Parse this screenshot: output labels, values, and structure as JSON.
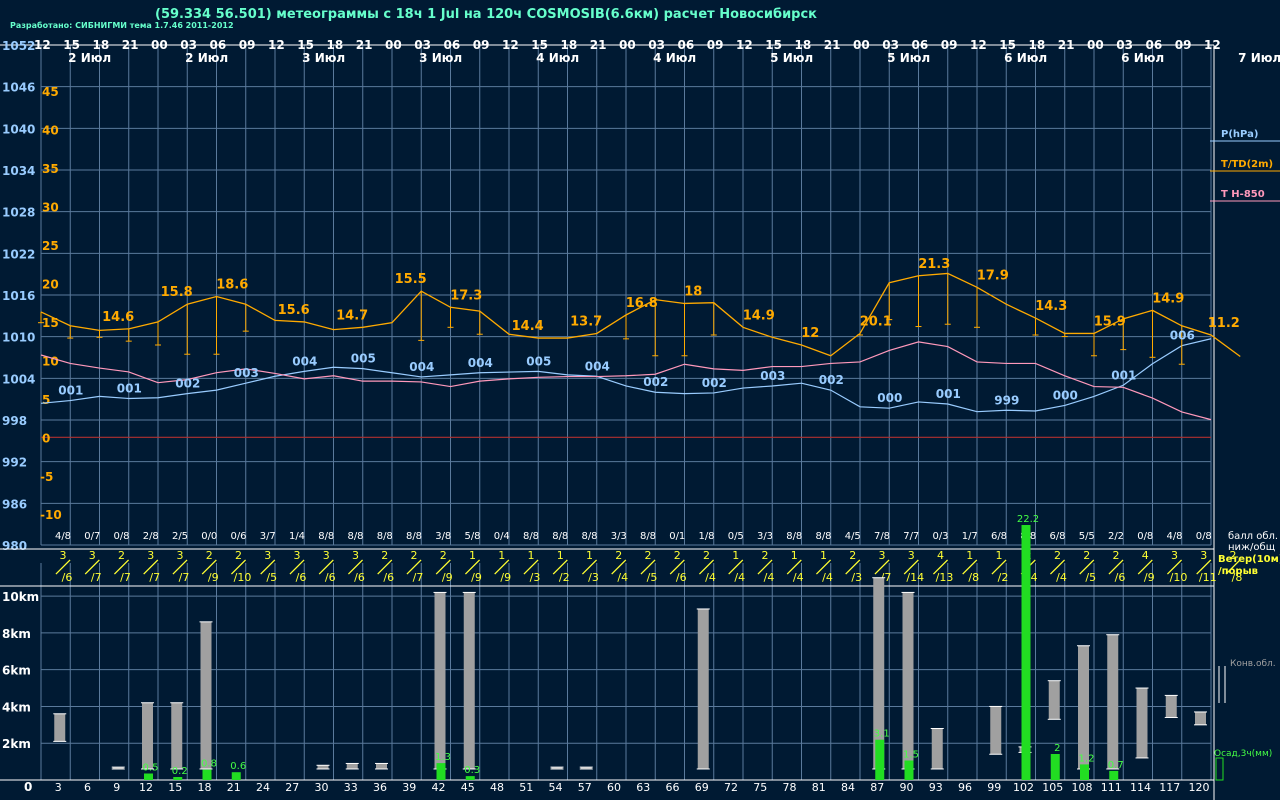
{
  "header": {
    "title": "(59.334 56.501) метеограммы с  18ч 1 Jul на 120ч COSMOSIB(6.6км) расчет Новосибирск",
    "credit": "Разработано: СИБНИГМИ тема 1.7.46 2011-2012"
  },
  "colors": {
    "background": "#001a33",
    "grid": "#5a7a9c",
    "pressure": "#99ccff",
    "temperature": "#ffaa00",
    "t850": "#ff99bb",
    "zero_line": "#b03030",
    "wind": "#ffff33",
    "cloud_bar": "#a0a0a0",
    "precip": "#22dd22",
    "precip_label": "#44ff44",
    "white": "#ffffff"
  },
  "chart_data": {
    "type": "line",
    "hours_top": [
      "12",
      "15",
      "18",
      "21",
      "00",
      "03",
      "06",
      "09",
      "12",
      "15",
      "18",
      "21",
      "00",
      "03",
      "06",
      "09",
      "12",
      "15",
      "18",
      "21",
      "00",
      "03",
      "06",
      "09",
      "12",
      "15",
      "18",
      "21",
      "00",
      "03",
      "06",
      "09",
      "12",
      "15",
      "18",
      "21",
      "00",
      "03",
      "06",
      "09",
      "12"
    ],
    "dates_top": [
      {
        "i": 1.1,
        "text": "2 Июл"
      },
      {
        "i": 5.1,
        "text": "2 Июл"
      },
      {
        "i": 9.1,
        "text": "3 Июл"
      },
      {
        "i": 13.1,
        "text": "3 Июл"
      },
      {
        "i": 17.1,
        "text": "4 Июл"
      },
      {
        "i": 21.1,
        "text": "4 Июл"
      },
      {
        "i": 25.1,
        "text": "5 Июл"
      },
      {
        "i": 29.1,
        "text": "5 Июл"
      },
      {
        "i": 33.1,
        "text": "6 Июл"
      },
      {
        "i": 37.1,
        "text": "6 Июл"
      },
      {
        "i": 41.1,
        "text": "7 Июл"
      }
    ],
    "forecast_hours": [
      "0",
      "3",
      "6",
      "9",
      "12",
      "15",
      "18",
      "21",
      "24",
      "27",
      "30",
      "33",
      "36",
      "39",
      "42",
      "45",
      "48",
      "51",
      "54",
      "57",
      "60",
      "63",
      "66",
      "69",
      "72",
      "75",
      "78",
      "81",
      "84",
      "87",
      "90",
      "93",
      "96",
      "99",
      "102",
      "105",
      "108",
      "111",
      "114",
      "117",
      "120"
    ],
    "pressure_axis": {
      "min": 980,
      "max": 1052,
      "ticks": [
        "1052",
        "1046",
        "1040",
        "1034",
        "1028",
        "1022",
        "1016",
        "1010",
        "1004",
        "998",
        "992",
        "986",
        "980"
      ]
    },
    "temperature_axis": {
      "min": -14,
      "max": 51,
      "ticks": [
        "45",
        "40",
        "35",
        "30",
        "25",
        "20",
        "15",
        "10",
        "5",
        "0",
        "-5",
        "-10"
      ]
    },
    "pressure": [
      1000.4,
      1000.8,
      1001.4,
      1001.1,
      1001.2,
      1001.8,
      1002.3,
      1003.3,
      1004.3,
      1005.0,
      1005.6,
      1005.4,
      1004.8,
      1004.2,
      1004.5,
      1004.8,
      1004.9,
      1005.0,
      1004.5,
      1004.3,
      1002.9,
      1002.0,
      1001.8,
      1001.9,
      1002.6,
      1002.9,
      1003.3,
      1002.3,
      999.9,
      999.7,
      1000.6,
      1000.3,
      999.2,
      999.4,
      999.3,
      1000.1,
      1001.4,
      1003.0,
      1006.1,
      1008.7,
      1009.7
    ],
    "pressure_labels": [
      {
        "i": 1,
        "text": "001"
      },
      {
        "i": 3,
        "text": "001"
      },
      {
        "i": 5,
        "text": "002"
      },
      {
        "i": 7,
        "text": "003"
      },
      {
        "i": 9,
        "text": "004"
      },
      {
        "i": 11,
        "text": "005"
      },
      {
        "i": 13,
        "text": "004"
      },
      {
        "i": 15,
        "text": "004"
      },
      {
        "i": 17,
        "text": "005"
      },
      {
        "i": 19,
        "text": "004"
      },
      {
        "i": 21,
        "text": "002"
      },
      {
        "i": 23,
        "text": "002"
      },
      {
        "i": 25,
        "text": "003"
      },
      {
        "i": 27,
        "text": "002"
      },
      {
        "i": 29,
        "text": "000"
      },
      {
        "i": 31,
        "text": "001"
      },
      {
        "i": 33,
        "text": "999"
      },
      {
        "i": 35,
        "text": "000"
      },
      {
        "i": 37,
        "text": "001"
      },
      {
        "i": 39,
        "text": "006"
      }
    ],
    "temperature": [
      16.3,
      14.5,
      13.9,
      14.1,
      15.0,
      17.3,
      18.3,
      17.3,
      15.2,
      15.0,
      14.0,
      14.3,
      14.9,
      19.0,
      16.9,
      16.4,
      13.4,
      12.9,
      12.9,
      13.5,
      15.9,
      17.9,
      17.4,
      17.5,
      14.3,
      13.0,
      12.0,
      10.6,
      13.5,
      20.1,
      21.0,
      21.3,
      19.5,
      17.3,
      15.5,
      13.5,
      13.5,
      15.4,
      16.5,
      14.5,
      13.3,
      10.5
    ],
    "dewpoint": [
      14.9,
      12.9,
      13.0,
      12.5,
      12.0,
      10.8,
      10.8,
      13.8,
      null,
      null,
      null,
      null,
      null,
      12.6,
      14.3,
      13.4,
      null,
      null,
      null,
      null,
      12.8,
      10.6,
      10.6,
      13.3,
      null,
      null,
      null,
      null,
      13.3,
      15.3,
      14.4,
      14.7,
      14.3,
      null,
      13.3,
      13.1,
      10.6,
      11.4,
      10.4,
      9.5
    ],
    "temperature_labels": [
      {
        "i": 2.5,
        "text": "14.6"
      },
      {
        "i": 4.5,
        "text": "15.8"
      },
      {
        "i": 6.4,
        "text": "18.6"
      },
      {
        "i": 8.5,
        "text": "15.6"
      },
      {
        "i": 10.5,
        "text": "14.7"
      },
      {
        "i": 12.5,
        "text": "15.5"
      },
      {
        "i": 14.4,
        "text": "17.3"
      },
      {
        "i": 16.5,
        "text": "14.4"
      },
      {
        "i": 18.5,
        "text": "13.7"
      },
      {
        "i": 20.4,
        "text": "16.8"
      },
      {
        "i": 22.4,
        "text": "18"
      },
      {
        "i": 24.4,
        "text": "14.9"
      },
      {
        "i": 26.4,
        "text": "12"
      },
      {
        "i": 28.4,
        "text": "20.1"
      },
      {
        "i": 30.4,
        "text": "21.3"
      },
      {
        "i": 32.4,
        "text": "17.9"
      },
      {
        "i": 34.4,
        "text": "14.3"
      },
      {
        "i": 36.4,
        "text": "15.9"
      },
      {
        "i": 38.4,
        "text": "14.9"
      },
      {
        "i": 40.3,
        "text": "11.2"
      }
    ],
    "t850": [
      10.7,
      9.6,
      9.0,
      8.5,
      7.1,
      7.5,
      8.4,
      8.9,
      8.3,
      7.6,
      8.0,
      7.3,
      7.3,
      7.2,
      6.6,
      7.3,
      7.6,
      7.8,
      7.9,
      7.9,
      8.0,
      8.2,
      9.5,
      8.9,
      8.7,
      9.2,
      9.2,
      9.6,
      9.8,
      11.3,
      12.4,
      11.8,
      9.8,
      9.6,
      9.6,
      8.0,
      6.6,
      6.5,
      5.1,
      3.3,
      2.3
    ],
    "cloud_cover": [
      "4/8",
      "0/7",
      "0/8",
      "2/8",
      "2/5",
      "0/0",
      "0/6",
      "3/7",
      "1/4",
      "8/8",
      "8/8",
      "8/8",
      "8/8",
      "3/8",
      "5/8",
      "0/4",
      "8/8",
      "8/8",
      "8/8",
      "3/3",
      "8/8",
      "0/1",
      "1/8",
      "0/5",
      "3/3",
      "8/8",
      "8/8",
      "4/5",
      "7/8",
      "7/7",
      "0/3",
      "1/7",
      "6/8",
      "8/8",
      "6/8",
      "5/5",
      "2/2",
      "0/8",
      "4/8",
      "0/8"
    ],
    "cloud_cover_label": [
      "балл обл.",
      "ниж/общ"
    ],
    "wind_speed": [
      "3",
      "3",
      "2",
      "3",
      "3",
      "2",
      "2",
      "3",
      "3",
      "3",
      "3",
      "2",
      "2",
      "2",
      "1",
      "1",
      "1",
      "1",
      "1",
      "2",
      "2",
      "2",
      "2",
      "1",
      "2",
      "1",
      "1",
      "2",
      "3",
      "3",
      "4",
      "1",
      "1",
      "2",
      "2",
      "2",
      "2",
      "4",
      "3",
      "3",
      "2"
    ],
    "wind_gust": [
      "/6",
      "/7",
      "/7",
      "/7",
      "/7",
      "/9",
      "/10",
      "/5",
      "/6",
      "/6",
      "/6",
      "/6",
      "/7",
      "/9",
      "/9",
      "/9",
      "/3",
      "/2",
      "/3",
      "/4",
      "/5",
      "/6",
      "/4",
      "/4",
      "/4",
      "/4",
      "/4",
      "/3",
      "/7",
      "/14",
      "/13",
      "/8",
      "/2",
      "/4",
      "/4",
      "/5",
      "/6",
      "/9",
      "/10",
      "/11",
      "/8"
    ],
    "wind_dir": [
      135,
      135,
      135,
      135,
      135,
      135,
      135,
      135,
      135,
      135,
      135,
      135,
      135,
      135,
      135,
      135,
      135,
      135,
      135,
      135,
      135,
      135,
      135,
      135,
      135,
      135,
      135,
      135,
      135,
      135,
      135,
      135,
      135,
      135,
      135,
      135,
      135,
      135,
      135,
      135,
      135
    ],
    "wind_label": [
      "Ветер(10м)",
      "/порыв"
    ],
    "cloud_axis_ticks": [
      "10km",
      "8km",
      "6km",
      "4km",
      "2km",
      "0"
    ],
    "convective_clouds": [
      {
        "i": 1,
        "base": 2.1,
        "top": 3.6
      },
      {
        "i": 3,
        "base": 0.6,
        "top": 0.7
      },
      {
        "i": 4,
        "base": 0.6,
        "top": 4.2
      },
      {
        "i": 5,
        "base": 0.6,
        "top": 4.2
      },
      {
        "i": 6,
        "base": 0.6,
        "top": 8.6
      },
      {
        "i": 10,
        "base": 0.6,
        "top": 0.8
      },
      {
        "i": 11,
        "base": 0.6,
        "top": 0.9
      },
      {
        "i": 12,
        "base": 0.6,
        "top": 0.9
      },
      {
        "i": 14,
        "base": 0.6,
        "top": 10.2
      },
      {
        "i": 15,
        "base": 0.6,
        "top": 10.2
      },
      {
        "i": 18,
        "base": 0.6,
        "top": 0.7
      },
      {
        "i": 19,
        "base": 0.6,
        "top": 0.7
      },
      {
        "i": 23,
        "base": 0.6,
        "top": 9.3
      },
      {
        "i": 29,
        "base": 0.6,
        "top": 11.0
      },
      {
        "i": 30,
        "base": 0.6,
        "top": 10.2
      },
      {
        "i": 31,
        "base": 0.6,
        "top": 2.8
      },
      {
        "i": 33,
        "base": 1.4,
        "top": 4.0
      },
      {
        "i": 34,
        "base": 1.5,
        "top": 1.8
      },
      {
        "i": 35,
        "base": 3.3,
        "top": 5.4
      },
      {
        "i": 36,
        "base": 0.6,
        "top": 7.3
      },
      {
        "i": 37,
        "base": 0.6,
        "top": 7.9
      },
      {
        "i": 38,
        "base": 1.2,
        "top": 5.0
      },
      {
        "i": 39,
        "base": 3.4,
        "top": 4.6
      },
      {
        "i": 40,
        "base": 3.0,
        "top": 3.7
      }
    ],
    "convective_label": "Конв.обл.",
    "precipitation": [
      {
        "i": 4,
        "value": 0.5,
        "text": "0.5"
      },
      {
        "i": 5,
        "value": 0.2,
        "text": "0.2"
      },
      {
        "i": 6,
        "value": 0.8,
        "text": "0.8"
      },
      {
        "i": 7,
        "value": 0.6,
        "text": "0.6"
      },
      {
        "i": 14,
        "value": 1.3,
        "text": "1.3"
      },
      {
        "i": 15,
        "value": 0.3,
        "text": "0.3"
      },
      {
        "i": 29,
        "value": 3.1,
        "text": "3.1"
      },
      {
        "i": 30,
        "value": 1.5,
        "text": "1.5"
      },
      {
        "i": 34,
        "value": 22.2,
        "text": "22.2"
      },
      {
        "i": 35,
        "value": 2,
        "text": "2"
      },
      {
        "i": 36,
        "value": 1.2,
        "text": "1.2"
      },
      {
        "i": 37,
        "value": 0.7,
        "text": "0.7"
      }
    ],
    "precip_label": "Осад,3ч(мм)",
    "legend": [
      {
        "text": "P(hPa)",
        "color_key": "pressure"
      },
      {
        "text": "T/TD(2m)",
        "color_key": "temperature"
      },
      {
        "text": "T H-850",
        "color_key": "t850"
      }
    ]
  }
}
